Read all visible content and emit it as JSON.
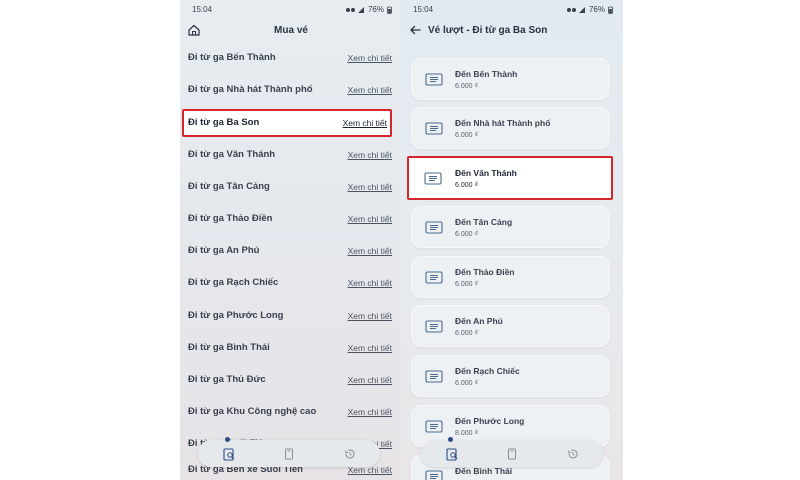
{
  "left_screen": {
    "status": {
      "time": "15:04",
      "battery": "76%"
    },
    "header": {
      "title": "Mua vé"
    },
    "link_label": "Xem chi tiết",
    "rows": [
      {
        "label": "Đi từ ga Bến Thành"
      },
      {
        "label": "Đi từ ga Nhà hát Thành phố"
      },
      {
        "label": "Đi từ ga Ba Son",
        "highlighted": true
      },
      {
        "label": "Đi từ ga Văn Thánh"
      },
      {
        "label": "Đi từ ga Tân Cảng"
      },
      {
        "label": "Đi từ ga Thảo Điền"
      },
      {
        "label": "Đi từ ga An Phú"
      },
      {
        "label": "Đi từ ga Rạch Chiếc"
      },
      {
        "label": "Đi từ ga Phước Long"
      },
      {
        "label": "Đi từ ga Bình Thái"
      },
      {
        "label": "Đi từ ga Thủ Đức"
      },
      {
        "label": "Đi từ ga Khu Công nghệ cao"
      },
      {
        "label": "Đi từ ga Suối Tiên"
      },
      {
        "label": "Đi từ ga Bến xe Suối Tiên"
      }
    ]
  },
  "right_screen": {
    "status": {
      "time": "15:04",
      "battery": "76%"
    },
    "header": {
      "title": "Vé lượt - Đi từ ga Ba Son"
    },
    "cards": [
      {
        "name": "Đến Bến Thành",
        "price": "6.000 ₫"
      },
      {
        "name": "Đến Nhà hát Thành phố",
        "price": "6.000 ₫"
      },
      {
        "name": "Đến Văn Thánh",
        "price": "6.000 ₫",
        "highlighted": true
      },
      {
        "name": "Đến Tân Cảng",
        "price": "6.000 ₫"
      },
      {
        "name": "Đến Thảo Điền",
        "price": "6.000 ₫"
      },
      {
        "name": "Đến An Phú",
        "price": "6.000 ₫"
      },
      {
        "name": "Đến Rạch Chiếc",
        "price": "6.000 ₫"
      },
      {
        "name": "Đến Phước Long",
        "price": "8.000 ₫"
      },
      {
        "name": "Đến Bình Thái",
        "price": ""
      }
    ]
  },
  "colors": {
    "highlight_border": "#d7262b",
    "nav_active_dot": "#2f4a8a"
  },
  "icons": {
    "home": "home-icon",
    "back": "back-arrow-icon",
    "ticket": "ticket-icon",
    "nav": [
      "ticket-search-icon",
      "card-icon",
      "history-icon"
    ]
  }
}
